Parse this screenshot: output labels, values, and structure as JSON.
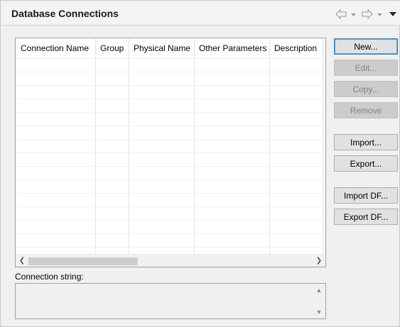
{
  "window": {
    "title": "Database Connections"
  },
  "table": {
    "columns": [
      "Connection Name",
      "Group",
      "Physical Name",
      "Other Parameters",
      "Description"
    ],
    "rows": []
  },
  "buttons": {
    "new": "New...",
    "edit": "Edit...",
    "copy": "Copy...",
    "remove": "Remove",
    "import": "Import...",
    "export": "Export...",
    "import_df": "Import DF...",
    "export_df": "Export DF..."
  },
  "connection_string": {
    "label": "Connection string:",
    "value": ""
  },
  "icons": {
    "back": "back-arrow-icon",
    "forward": "forward-arrow-icon",
    "menu": "view-menu-icon"
  },
  "colors": {
    "default_button_border": "#3c7fb1",
    "disabled_text": "#838383"
  }
}
